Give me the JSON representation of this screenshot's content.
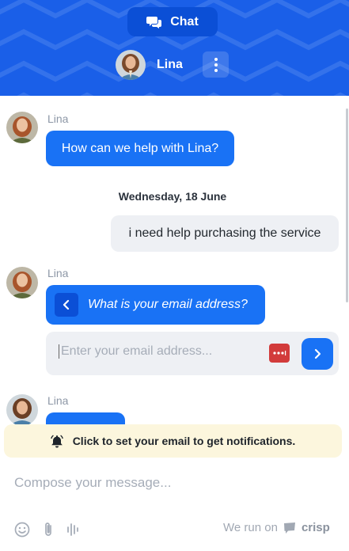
{
  "header": {
    "chat_label": "Chat",
    "operator_name": "Lina",
    "color": "#1a5fe8"
  },
  "messages": {
    "greeting_sender": "Lina",
    "greeting_text": "How can we help with Lina?",
    "date_separator": "Wednesday, 18 June",
    "user_text": "i need help purchasing the service",
    "question_sender": "Lina",
    "question_text": "What is your email address?",
    "third_sender": "Lina"
  },
  "email_prompt": {
    "placeholder": "Enter your email address..."
  },
  "notification": {
    "text": "Click to set your email to get notifications.",
    "icon": "bell-icon"
  },
  "composer": {
    "placeholder": "Compose your message...",
    "tools": [
      "emoji-icon",
      "attachment-icon",
      "audio-icon"
    ]
  },
  "branding": {
    "prefix": "We run on",
    "brand": "crisp"
  },
  "colors": {
    "accent": "#1972f5",
    "user_bubble": "#eef0f4",
    "notice_bg": "#fcf6dd"
  }
}
